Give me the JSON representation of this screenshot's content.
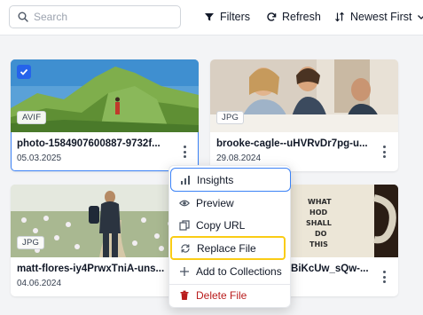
{
  "toolbar": {
    "search_placeholder": "Search",
    "filters_label": "Filters",
    "refresh_label": "Refresh",
    "sort_label": "Newest First"
  },
  "cards": [
    {
      "name": "photo-1584907600887-9732f...",
      "date": "05.03.2025",
      "type": "AVIF",
      "selected": true
    },
    {
      "name": "brooke-cagle--uHVRvDr7pg-u...",
      "date": "29.08.2024",
      "type": "JPG",
      "selected": false
    },
    {
      "name": "matt-flores-iy4PrwxTniA-uns...",
      "date": "04.06.2024",
      "type": "JPG",
      "selected": false
    },
    {
      "name": "FBiKcUw_sQw-...",
      "date": "",
      "type": "",
      "selected": false
    }
  ],
  "mug_text": [
    "WHAT",
    "HOD",
    "SHALL",
    "DO",
    "THIS"
  ],
  "context_menu": {
    "items": [
      {
        "label": "Insights",
        "icon": "chart-icon"
      },
      {
        "label": "Preview",
        "icon": "eye-icon"
      },
      {
        "label": "Copy URL",
        "icon": "copy-icon"
      },
      {
        "label": "Replace File",
        "icon": "replace-icon"
      },
      {
        "label": "Add to Collections",
        "icon": "plus-icon"
      },
      {
        "label": "Delete File",
        "icon": "trash-icon"
      }
    ]
  },
  "colors": {
    "accent": "#3b82f6",
    "highlight": "#facc15",
    "danger": "#b91c1c"
  }
}
